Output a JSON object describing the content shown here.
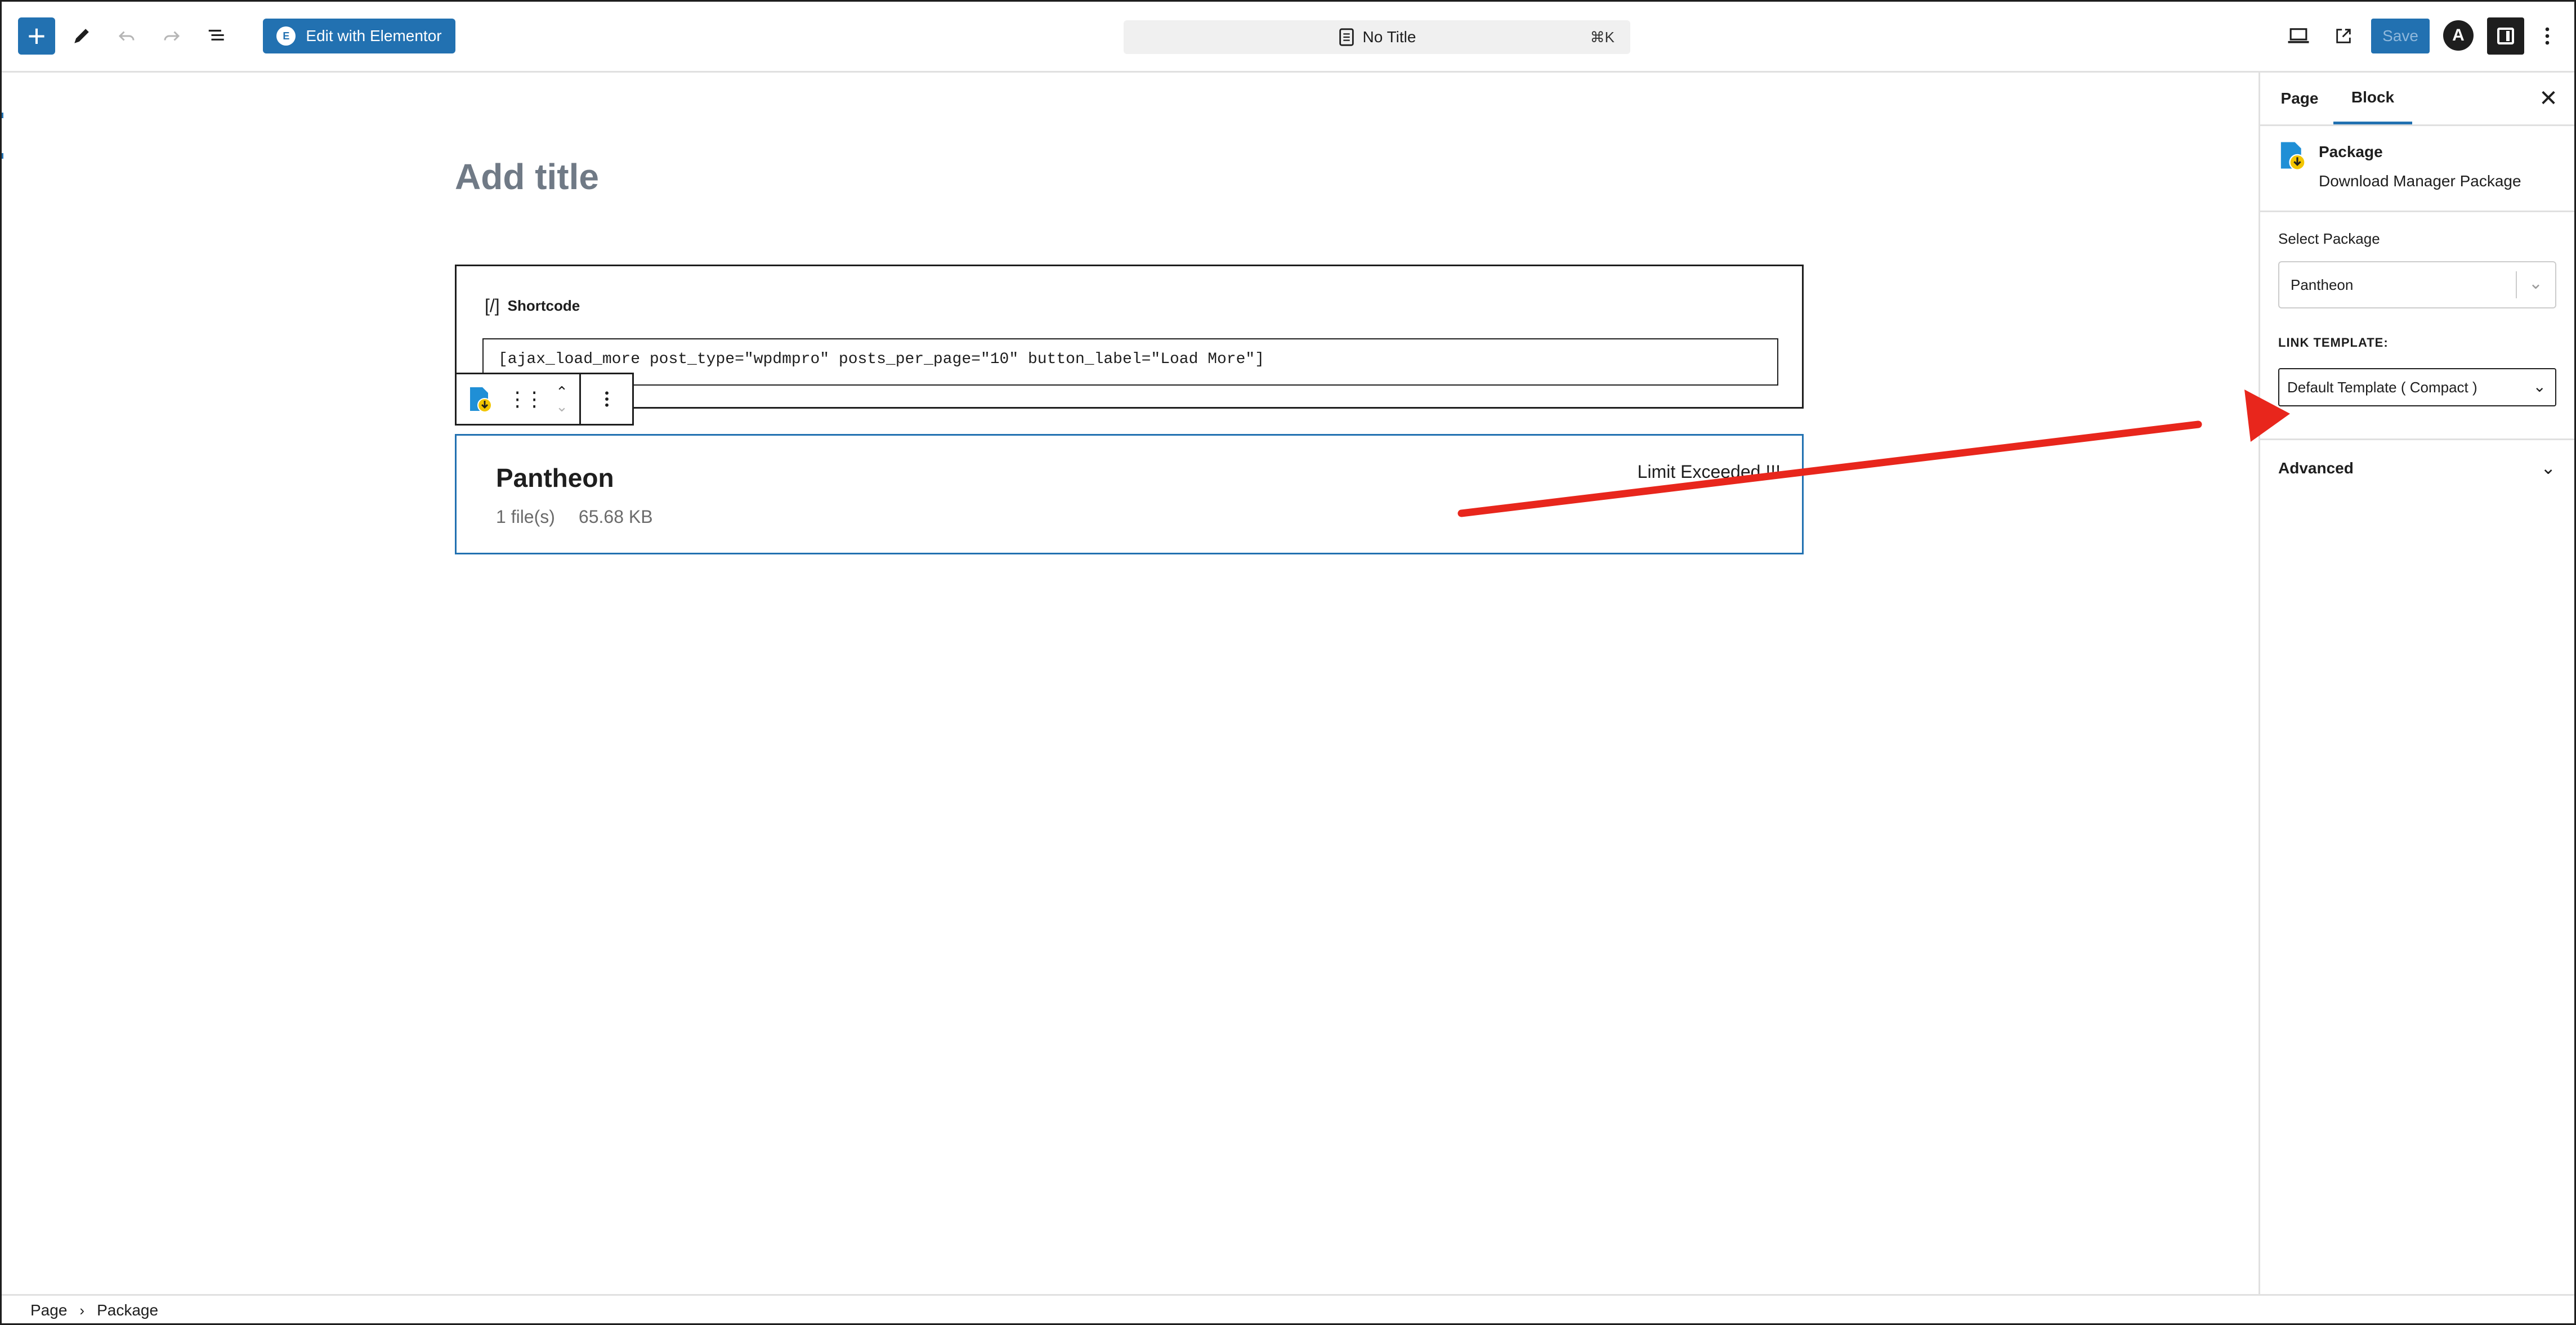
{
  "toolbar": {
    "edit_elementor_label": "Edit with Elementor",
    "elementor_logo_text": "E",
    "document_title": "No Title",
    "command_shortcut": "⌘K",
    "save_label": "Save",
    "astra_logo_text": "A"
  },
  "editor": {
    "title_placeholder": "Add title",
    "shortcode_block": {
      "icon_text": "[/]",
      "label": "Shortcode",
      "value": "[ajax_load_more post_type=\"wpdmpro\" posts_per_page=\"10\" button_label=\"Load More\"]"
    },
    "package_block": {
      "name": "Pantheon",
      "file_count": "1 file(s)",
      "file_size": "65.68 KB",
      "status": "Limit Exceeded !!!"
    }
  },
  "sidebar": {
    "tabs": [
      "Page",
      "Block"
    ],
    "active_tab": "Block",
    "block_card": {
      "title": "Package",
      "description": "Download Manager Package"
    },
    "select_package_label": "Select Package",
    "selected_package": "Pantheon",
    "link_template_label": "LINK TEMPLATE:",
    "link_template_value": "Default Template ( Compact )",
    "advanced_label": "Advanced"
  },
  "breadcrumb": [
    "Page",
    "Package"
  ],
  "colors": {
    "accent": "#2271b1",
    "annotation_arrow": "#e8261c"
  },
  "icons": {
    "add": "plus-icon",
    "tools": "pencil-icon",
    "undo": "undo-icon",
    "redo": "redo-icon",
    "outline": "list-view-icon",
    "view": "laptop-icon",
    "preview": "external-link-icon",
    "settings": "sidebar-toggle-icon",
    "options": "more-vertical-icon"
  }
}
